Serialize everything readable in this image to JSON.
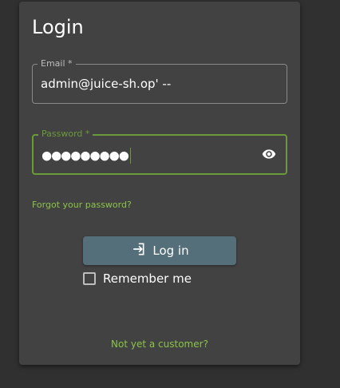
{
  "login": {
    "title": "Login",
    "email": {
      "label": "Email *",
      "value": "admin@juice-sh.op' --"
    },
    "password": {
      "label": "Password *",
      "masked_value": "●●●●●●●●●",
      "icon": "eye-icon"
    },
    "forgot_link": "Forgot your password?",
    "login_button": {
      "label": "Log in",
      "icon": "login-icon"
    },
    "remember_me": {
      "label": "Remember me",
      "checked": false
    },
    "register_link": "Not yet a customer?"
  },
  "colors": {
    "background": "#303030",
    "card": "#424242",
    "accent": "#6b9a3a",
    "link": "#8bc34a",
    "button": "#546e7a"
  }
}
